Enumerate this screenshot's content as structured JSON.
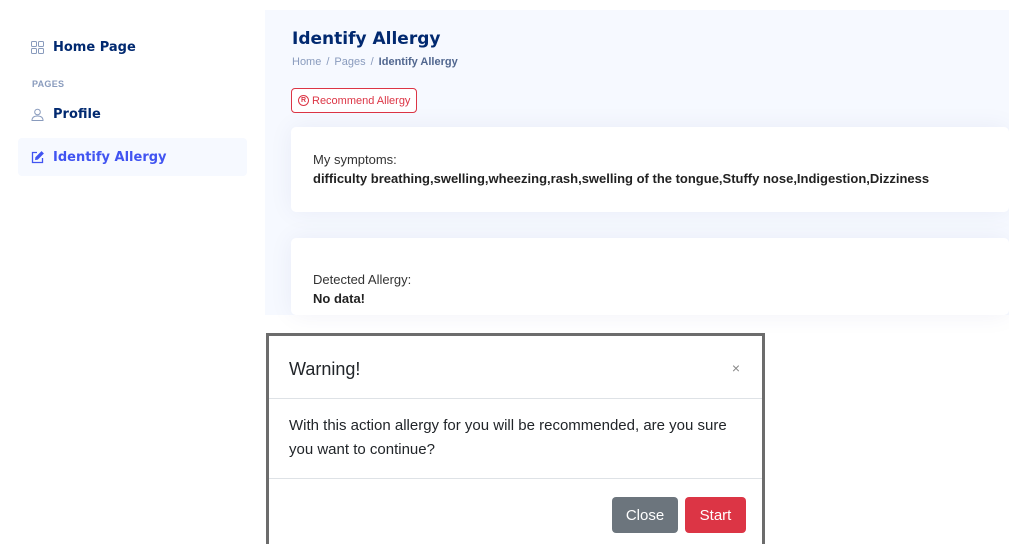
{
  "sidebar": {
    "home_label": "Home Page",
    "section_heading": "PAGES",
    "profile_label": "Profile",
    "identify_label": "Identify Allergy"
  },
  "main": {
    "page_title": "Identify Allergy",
    "breadcrumb": [
      "Home",
      "Pages",
      "Identify Allergy"
    ],
    "recommend_button": "Recommend Allergy",
    "symptoms_label": "My symptoms:",
    "symptoms_value": "difficulty breathing,swelling,wheezing,rash,swelling of the tongue,Stuffy nose,Indigestion,Dizziness",
    "detected_label": "Detected Allergy:",
    "detected_value": "No data!"
  },
  "modal": {
    "title": "Warning!",
    "close_symbol": "×",
    "body": "With this action allergy for you will be recommended, are you sure you want to continue?",
    "close_button": "Close",
    "start_button": "Start"
  },
  "colors": {
    "navy": "#012970",
    "accent": "#4154f1",
    "danger": "#dc3545",
    "secondary": "#6c757d"
  }
}
